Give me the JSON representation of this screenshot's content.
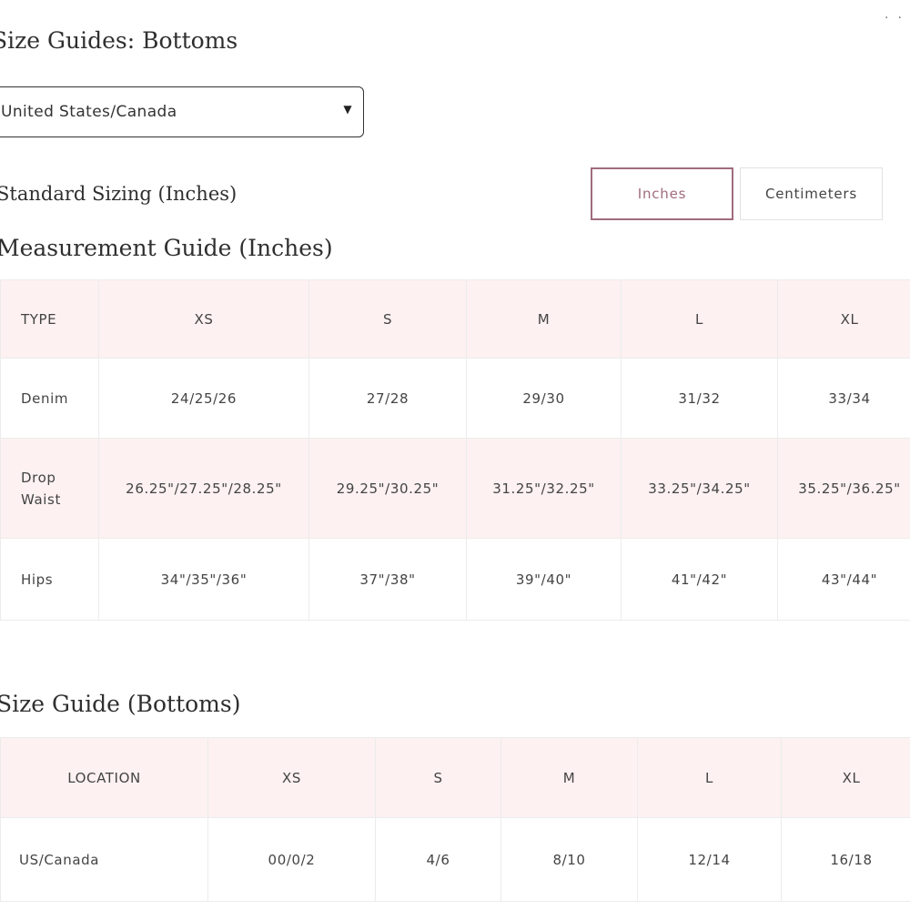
{
  "page": {
    "title": "Size Guides: Bottoms"
  },
  "region_select": {
    "value": "United States/Canada",
    "arrow": "▼"
  },
  "sizing": {
    "label": "Standard Sizing (Inches)",
    "units": [
      {
        "label": "Inches",
        "selected": true
      },
      {
        "label": "Centimeters",
        "selected": false
      }
    ],
    "accent_color": "#a06c7c"
  },
  "measurement_guide": {
    "title": "Measurement Guide (Inches)",
    "headers": [
      "TYPE",
      "XS",
      "S",
      "M",
      "L",
      "XL"
    ],
    "rows": [
      {
        "type": "Denim",
        "values": [
          "24/25/26",
          "27/28",
          "29/30",
          "31/32",
          "33/34"
        ]
      },
      {
        "type": "Drop Waist",
        "values": [
          "26.25\"/27.25\"/28.25\"",
          "29.25\"/30.25\"",
          "31.25\"/32.25\"",
          "33.25\"/34.25\"",
          "35.25\"/36.25\""
        ]
      },
      {
        "type": "Hips",
        "values": [
          "34\"/35\"/36\"",
          "37\"/38\"",
          "39\"/40\"",
          "41\"/42\"",
          "43\"/44\""
        ]
      }
    ]
  },
  "size_guide": {
    "title": "Size Guide (Bottoms)",
    "headers": [
      "LOCATION",
      "XS",
      "S",
      "M",
      "L",
      "XL"
    ],
    "rows": [
      {
        "location": "US/Canada",
        "values": [
          "00/0/2",
          "4/6",
          "8/10",
          "12/14",
          "16/18"
        ]
      }
    ]
  },
  "colors": {
    "pink_row": "#fdf1f1",
    "border": "#ececec"
  }
}
